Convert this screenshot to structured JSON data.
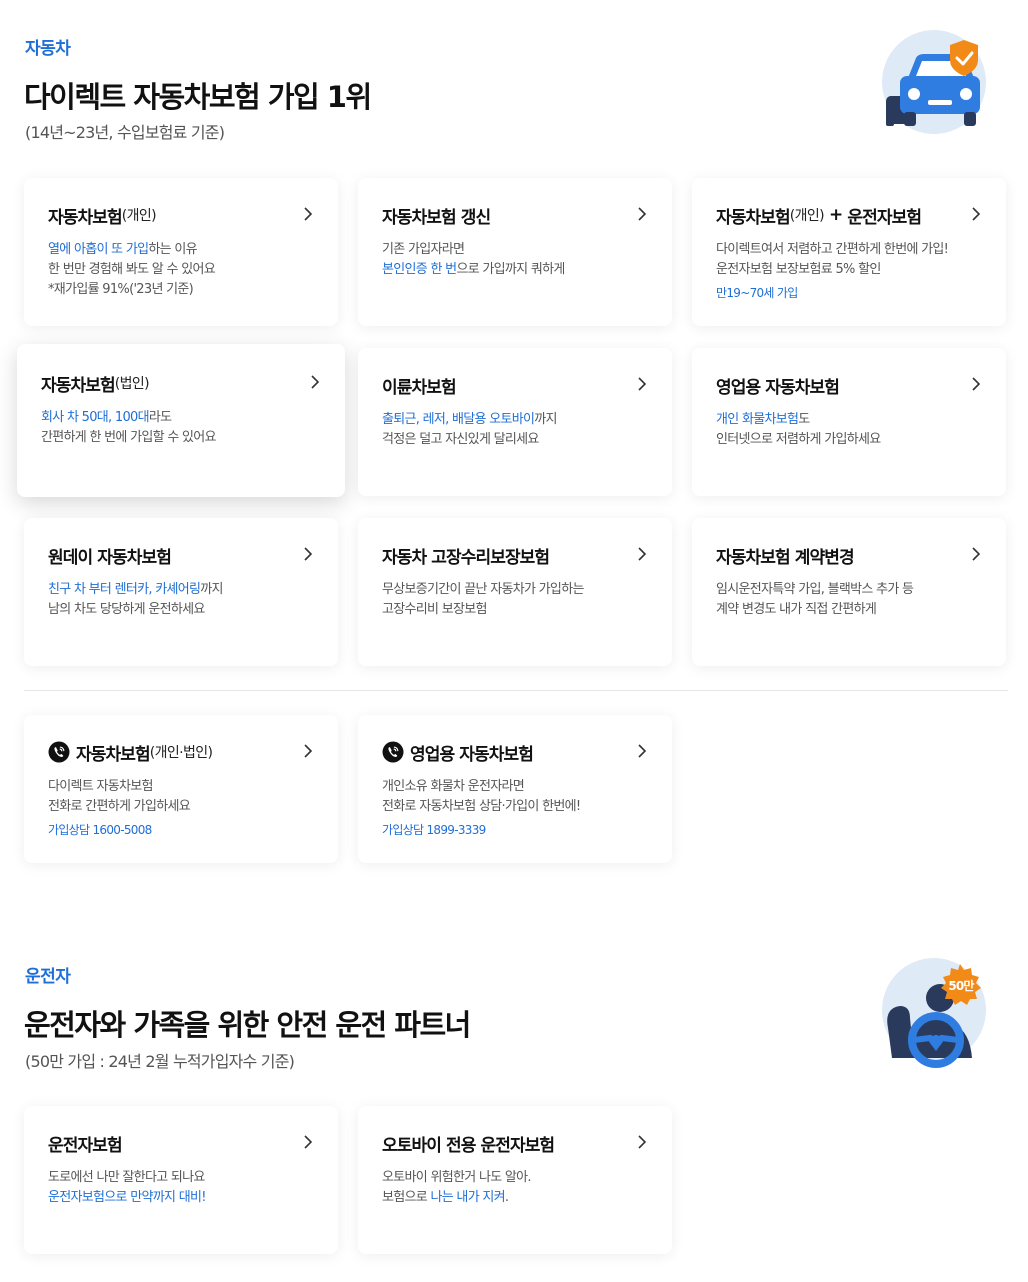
{
  "car_section": {
    "eyebrow": "자동차",
    "headline": "다이렉트 자동차보험 가입 1위",
    "subline": "(14년~23년, 수입보험료 기준)",
    "cards": [
      {
        "title": "자동차보험",
        "title_sub": "(개인)",
        "line1_hl": "열에 아홉이 또 가입",
        "line1_rest": "하는 이유",
        "line2": "한 번만 경험해 봐도 알 수 있어요",
        "line3": "*재가입률 91%('23년 기준)"
      },
      {
        "title": "자동차보험 갱신",
        "line1": "기존 가입자라면",
        "line2_hl": "본인인증 한 번",
        "line2_rest": "으로 가입까지 쿼하게"
      },
      {
        "title": "자동차보험",
        "title_sub": "(개인)",
        "plus": "+",
        "title2": "운전자보험",
        "line1": "다이렉트여서 저렴하고 간편하게 한번에 가입!",
        "line2": "운전자보험 보장보험료 5% 할인",
        "note": "만19~70세 가입"
      },
      {
        "title": "자동차보험",
        "title_sub": "(법인)",
        "line1_hl": "회사 차 50대, 100대",
        "line1_rest": "라도",
        "line2": "간편하게 한 번에 가입할 수 있어요"
      },
      {
        "title": "이륜차보험",
        "line1_hl": "출퇴근, 레저, 배달용 오토바이",
        "line1_rest": "까지",
        "line2": "걱정은 덜고 자신있게 달리세요"
      },
      {
        "title": "영업용 자동차보험",
        "line1_hl": "개인 화물차보험",
        "line1_rest": "도",
        "line2": "인터넷으로 저렴하게 가입하세요"
      },
      {
        "title": "원데이 자동차보험",
        "line1_hl": "친구 차 부터 렌터카, 카셰어링",
        "line1_rest": "까지",
        "line2": "남의 차도 당당하게 운전하세요"
      },
      {
        "title": "자동차 고장수리보장보험",
        "line1": "무상보증기간이 끝난 자동차가 가입하는",
        "line2": "고장수리비 보장보험"
      },
      {
        "title": "자동차보험 계약변경",
        "line1": "임시운전자특약 가입, 블랙박스 추가 등",
        "line2": "계약 변경도 내가 직접 간편하게"
      }
    ],
    "phone_cards": [
      {
        "title": "자동차보험",
        "title_sub": "(개인·법인)",
        "line1": "다이렉트 자동차보험",
        "line2": "전화로 간편하게 가입하세요",
        "note": "가입상담 1600-5008"
      },
      {
        "title": "영업용 자동차보험",
        "line1": "개인소유 화물차 운전자라면",
        "line2": "전화로 자동차보험 상담·가입이 한번에!",
        "note": "가입상담 1899-3339"
      }
    ]
  },
  "driver_section": {
    "eyebrow": "운전자",
    "headline": "운전자와 가족을 위한 안전 운전 파트너",
    "subline": "(50만 가입 : 24년 2월 누적가입자수 기준)",
    "badge": "50만",
    "cards": [
      {
        "title": "운전자보험",
        "line1": "도로에선 나만 잘한다고 되나요",
        "line2_hl": "운전자보험으로 만약까지 대비!"
      },
      {
        "title": "오토바이 전용 운전자보험",
        "line1": "오토바이 위험한거 나도 알아.",
        "line2_pre": "보험으로 ",
        "line2_hl": "나는 내가 지켜",
        "line2_post": "."
      }
    ]
  },
  "colors": {
    "accent": "#1f6fd6",
    "orange": "#f28a17",
    "navy": "#2a3a5c",
    "illus_bg": "#dfeaf7"
  },
  "icons": {
    "chevron": "chevron-right-icon",
    "phone": "phone-icon",
    "car": "car-shield-icon",
    "driver": "driver-icon"
  }
}
